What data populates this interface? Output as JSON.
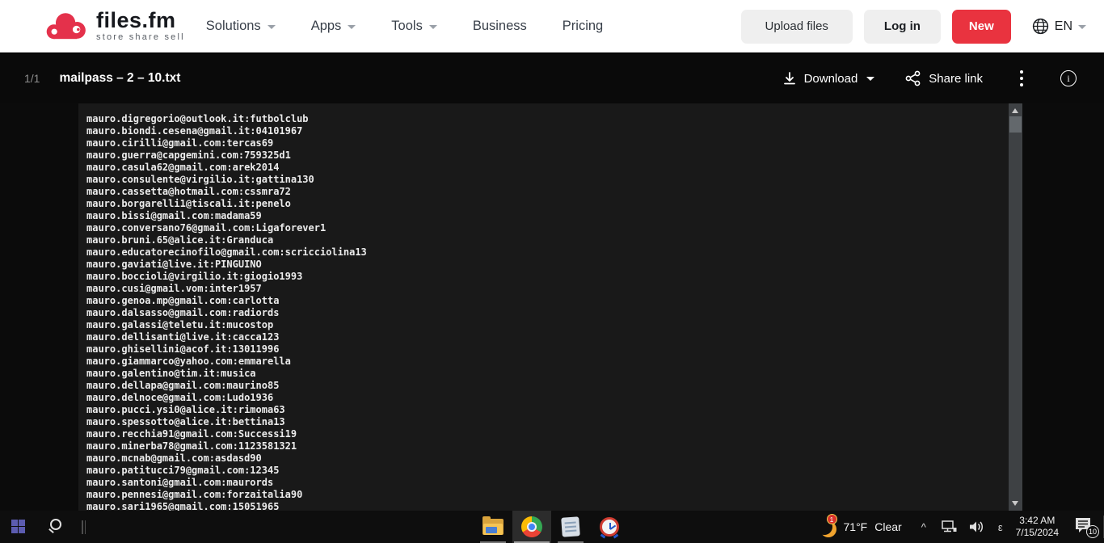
{
  "colors": {
    "brand_red": "#e4314b",
    "new_red": "#e9333f",
    "header_bg": "#ffffff",
    "toolbar_bg": "#0a0a0a",
    "page_bg": "#0b0b0b",
    "viewer_bg": "#191919",
    "taskbar_bg": "#0e0e0e",
    "file_text": "#ececec"
  },
  "header": {
    "logo": {
      "title": "files.fm",
      "tagline": "store share sell"
    },
    "nav": [
      {
        "label": "Solutions"
      },
      {
        "label": "Apps"
      },
      {
        "label": "Tools"
      },
      {
        "label": "Business"
      },
      {
        "label": "Pricing"
      }
    ],
    "upload_button": "Upload files",
    "login_button": "Log in",
    "new_button": "New",
    "language": "EN"
  },
  "toolbar": {
    "page_indicator": "1/1",
    "filename": "mailpass – 2 – 10.txt",
    "download_label": "Download",
    "share_label": "Share link"
  },
  "viewer": {
    "lines": [
      "mauro.digregorio@outlook.it:futbolclub",
      "mauro.biondi.cesena@gmail.it:04101967",
      "mauro.cirilli@gmail.com:tercas69",
      "mauro.guerra@capgemini.com:759325d1",
      "mauro.casula62@gmail.com:arek2014",
      "mauro.consulente@virgilio.it:gattina130",
      "mauro.cassetta@hotmail.com:cssmra72",
      "mauro.borgarelli1@tiscali.it:penelo",
      "mauro.bissi@gmail.com:madama59",
      "mauro.conversano76@gmail.com:Ligaforever1",
      "mauro.bruni.65@alice.it:Granduca",
      "mauro.educatorecinofilo@gmail.com:scricciolina13",
      "mauro.gaviati@live.it:PINGUINO",
      "mauro.boccioli@virgilio.it:giogio1993",
      "mauro.cusi@gmail.vom:inter1957",
      "mauro.genoa.mp@gmail.com:carlotta",
      "mauro.dalsasso@gmail.com:radiords",
      "mauro.galassi@teletu.it:mucostop",
      "mauro.dellisanti@live.it:cacca123",
      "mauro.ghisellini@acof.it:13011996",
      "mauro.giammarco@yahoo.com:emmarella",
      "mauro.galentino@tim.it:musica",
      "mauro.dellapa@gmail.com:maurino85",
      "mauro.delnoce@gmail.com:Ludo1936",
      "mauro.pucci.ysi0@alice.it:rimoma63",
      "mauro.spessotto@alice.it:bettina13",
      "mauro.recchia91@gmail.com:Successi19",
      "mauro.minerba78@gmail.com:1123581321",
      "mauro.mcnab@gmail.com:asdasd90",
      "mauro.patitucci79@gmail.com:12345",
      "mauro.santoni@gmail.com:maurords",
      "mauro.pennesi@gmail.com:forzaitalia90",
      "mauro.sari1965@gmail.com:15051965"
    ]
  },
  "taskbar": {
    "weather": {
      "temp": "71°F",
      "condition": "Clear",
      "badge": "1"
    },
    "tray_glyph": "ε",
    "chevron": "^",
    "clock": {
      "time": "3:42 AM",
      "date": "7/15/2024"
    },
    "notifications_badge": "10"
  }
}
